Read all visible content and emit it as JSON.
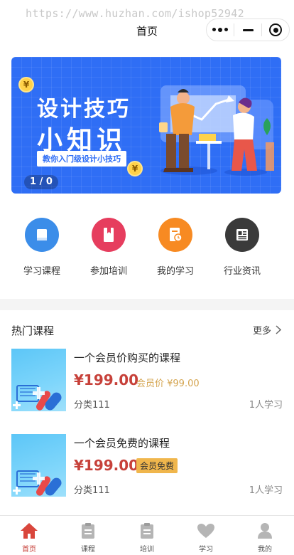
{
  "watermark": "https://www.huzhan.com/ishop52942",
  "header": {
    "title": "首页"
  },
  "banner": {
    "title_line1": "设计技巧",
    "title_line2": "小知识",
    "subtitle": "教你入门级设计小技巧",
    "coin_symbol": "¥",
    "counter": "1 / 0"
  },
  "quick_menu": [
    {
      "label": "学习课程",
      "icon": "book-icon",
      "color": "#3b8de9"
    },
    {
      "label": "参加培训",
      "icon": "bookmark-icon",
      "color": "#e63d5e"
    },
    {
      "label": "我的学习",
      "icon": "document-clock-icon",
      "color": "#f78a22"
    },
    {
      "label": "行业资讯",
      "icon": "newspaper-icon",
      "color": "#3a3a3a"
    }
  ],
  "hot_courses": {
    "title": "热门课程",
    "more": "更多",
    "items": [
      {
        "title": "一个会员价购买的课程",
        "price": "¥199.00",
        "member_text": "会员价 ¥99.00",
        "category": "分类111",
        "learners": "1人学习"
      },
      {
        "title": "一个会员免费的课程",
        "price": "¥199.00",
        "member_tag": "会员免费",
        "category": "分类111",
        "learners": "1人学习"
      }
    ]
  },
  "tabbar": [
    {
      "label": "首页",
      "icon": "home-icon",
      "active": true
    },
    {
      "label": "课程",
      "icon": "course-doc-icon",
      "active": false
    },
    {
      "label": "培训",
      "icon": "training-doc-icon",
      "active": false
    },
    {
      "label": "学习",
      "icon": "heart-icon",
      "active": false
    },
    {
      "label": "我的",
      "icon": "user-icon",
      "active": false
    }
  ],
  "colors": {
    "accent": "#c7413a",
    "banner_bg": "#2f6ef5",
    "member_gold": "#f0b64c"
  }
}
